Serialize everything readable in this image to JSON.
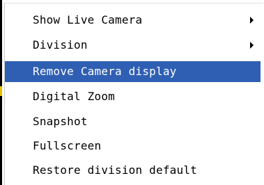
{
  "context_menu": {
    "items": [
      {
        "label": "Show Live Camera",
        "has_submenu": true,
        "selected": false
      },
      {
        "label": "Division",
        "has_submenu": true,
        "selected": false
      },
      {
        "label": "Remove Camera display",
        "has_submenu": false,
        "selected": true
      },
      {
        "label": "Digital Zoom",
        "has_submenu": false,
        "selected": false
      },
      {
        "label": "Snapshot",
        "has_submenu": false,
        "selected": false
      },
      {
        "label": "Fullscreen",
        "has_submenu": false,
        "selected": false
      },
      {
        "label": "Restore division default",
        "has_submenu": false,
        "selected": false
      }
    ],
    "colors": {
      "highlight": "#2f5fb3",
      "highlight_text": "#ffffff",
      "text": "#000000",
      "background": "#ffffff"
    },
    "icons": {
      "submenu": "triangle-right-icon"
    }
  }
}
